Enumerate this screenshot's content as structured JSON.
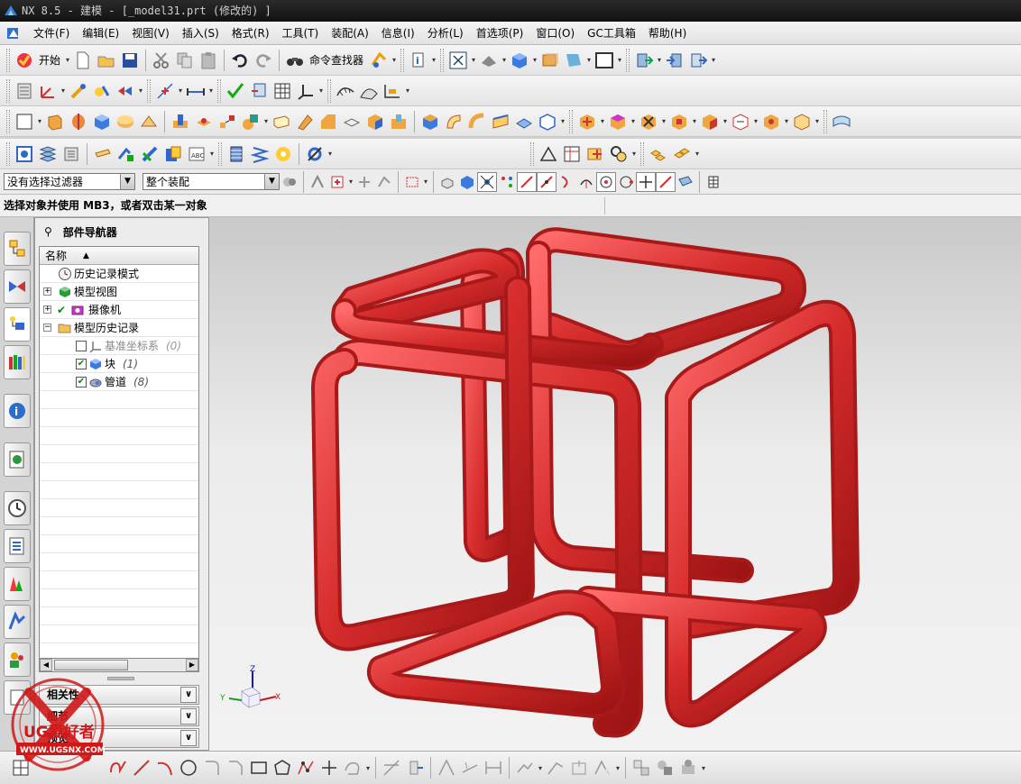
{
  "window": {
    "title": "NX 8.5 - 建模 - [_model31.prt (修改的) ]"
  },
  "menu": {
    "items": [
      "文件(F)",
      "编辑(E)",
      "视图(V)",
      "插入(S)",
      "格式(R)",
      "工具(T)",
      "装配(A)",
      "信息(I)",
      "分析(L)",
      "首选项(P)",
      "窗口(O)",
      "GC工具箱",
      "帮助(H)"
    ]
  },
  "toolbar": {
    "start_label": "开始",
    "command_finder_label": "命令查找器"
  },
  "filters": {
    "selection_filter": "没有选择过滤器",
    "assembly_scope": "整个装配"
  },
  "status": {
    "prompt": "选择对象并使用 MB3，或者双击某一对象"
  },
  "navigator": {
    "title": "部件导航器",
    "column_name": "名称",
    "tree": [
      {
        "label": "历史记录模式",
        "count": ""
      },
      {
        "label": "模型视图",
        "count": ""
      },
      {
        "label": "摄像机",
        "count": ""
      },
      {
        "label": "模型历史记录",
        "count": ""
      },
      {
        "label": "基准坐标系",
        "count": "(0)"
      },
      {
        "label": "块",
        "count": "(1)"
      },
      {
        "label": "管道",
        "count": "(8)"
      }
    ],
    "panels": [
      "相关性",
      "细节",
      "预览"
    ]
  },
  "viewport": {
    "axis_labels": {
      "x": "X",
      "y": "Y",
      "z": "Z"
    },
    "model_color": "#d62c2c"
  },
  "watermark": {
    "brand": "UG爱好者",
    "url": "WWW.UGSNX.COM"
  },
  "colors": {
    "title_bg": "#111111",
    "accent_blue": "#2f6fd0",
    "tube_red": "#d62c2c"
  }
}
